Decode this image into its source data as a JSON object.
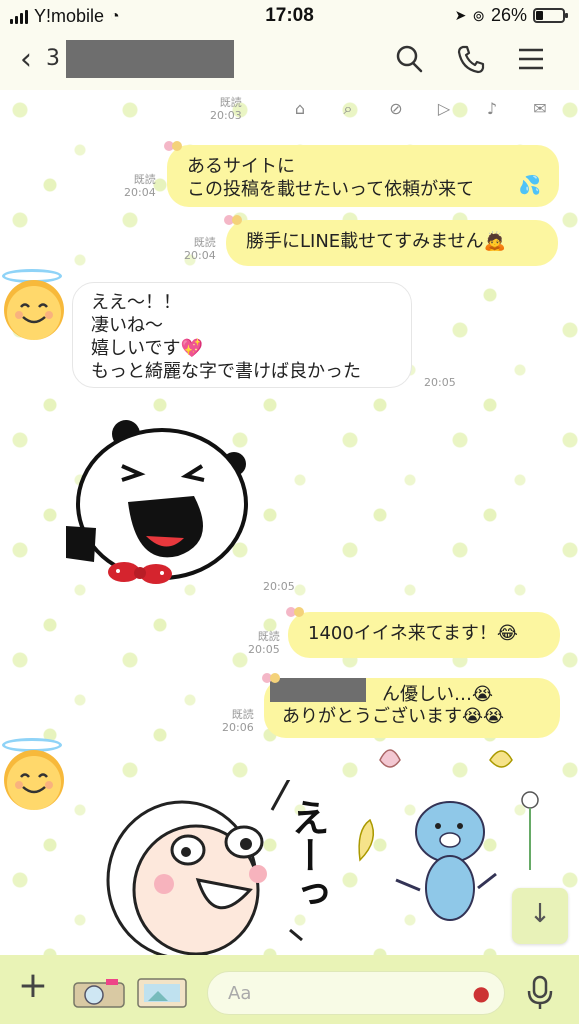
{
  "status_bar": {
    "carrier": "Y!mobile",
    "time": "17:08",
    "battery_percent_label": "26%",
    "battery_level": 0.26
  },
  "header": {
    "title_prefix": "3"
  },
  "mini_toolbar": [
    "home-icon",
    "search-icon",
    "cancel-icon",
    "play-icon",
    "bell-icon",
    "mail-icon"
  ],
  "messages": [
    {
      "side": "right",
      "read": "既読",
      "time": "20:03"
    },
    {
      "side": "right",
      "read": "既読",
      "time": "20:04",
      "text": "あるサイトに\nこの投稿を載せたいって依頼が来て",
      "emoji": "💦"
    },
    {
      "side": "right",
      "read": "既読",
      "time": "20:04",
      "text": "勝手にLINE載せてすみません",
      "emoji": "🙇"
    },
    {
      "side": "left",
      "time": "20:05",
      "text": "ええ〜！！\n凄いね〜\n嬉しいです",
      "emoji": "💖",
      "text2": "もっと綺麗な字で書けば良かった"
    },
    {
      "side": "left",
      "type": "sticker",
      "time": "20:05"
    },
    {
      "side": "right",
      "read": "既読",
      "time": "20:05",
      "text": "1400イイネ来てます！",
      "emoji": "😂"
    },
    {
      "side": "right",
      "read": "既読",
      "time": "20:06",
      "text_line1": "ん優しい…",
      "text_line2": "ありがとうございます",
      "emoji1": "😭",
      "emoji2": "😭😭"
    }
  ],
  "sticker_text": "えーっ",
  "input": {
    "placeholder": "Aa"
  },
  "colors": {
    "bubble_right": "#fcf6a0",
    "bubble_left": "#ffffff",
    "bar_bg": "#e9f3b6",
    "header_bg": "#fbfbf0"
  }
}
